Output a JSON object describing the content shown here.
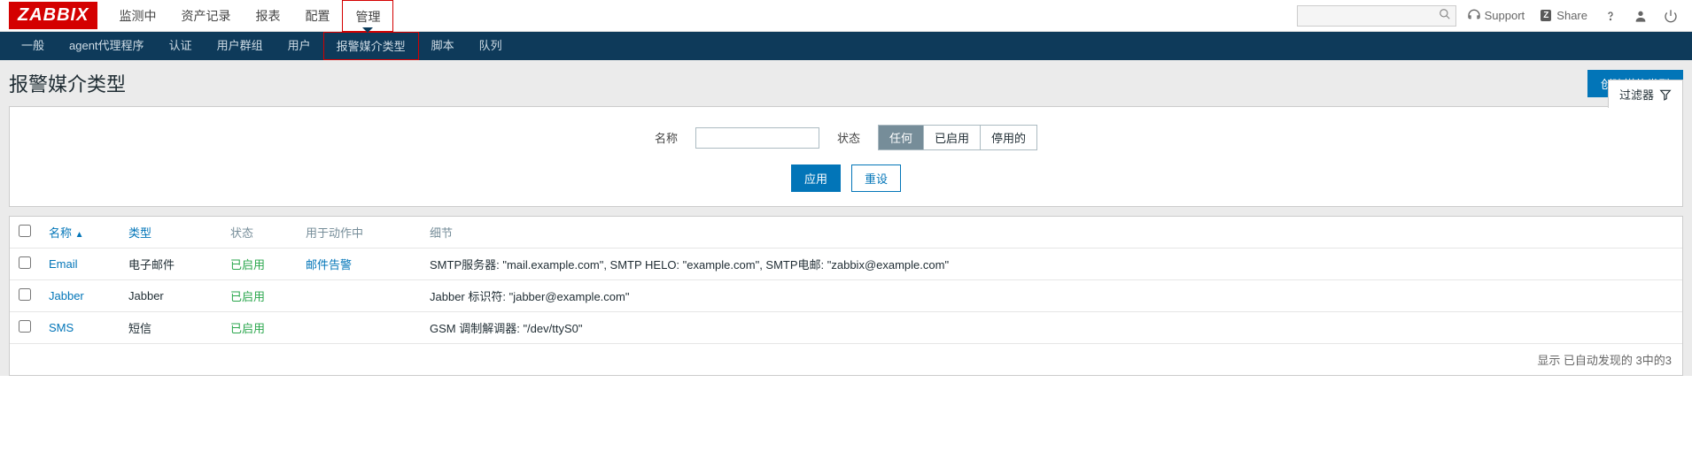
{
  "logo": "ZABBIX",
  "main_nav": {
    "items": [
      "监测中",
      "资产记录",
      "报表",
      "配置",
      "管理"
    ],
    "active_index": 4
  },
  "top_right": {
    "support": "Support",
    "share": "Share"
  },
  "sub_nav": {
    "items": [
      "一般",
      "agent代理程序",
      "认证",
      "用户群组",
      "用户",
      "报警媒介类型",
      "脚本",
      "队列"
    ],
    "active_index": 5
  },
  "page": {
    "title": "报警媒介类型",
    "create_button": "创建媒体类型"
  },
  "filter": {
    "tab_label": "过滤器",
    "name_label": "名称",
    "name_value": "",
    "state_label": "状态",
    "state_options": [
      "任何",
      "已启用",
      "停用的"
    ],
    "state_active_index": 0,
    "apply": "应用",
    "reset": "重设"
  },
  "table": {
    "headers": {
      "name": "名称",
      "type": "类型",
      "status": "状态",
      "used_in": "用于动作中",
      "detail": "细节"
    },
    "rows": [
      {
        "name": "Email",
        "type": "电子邮件",
        "status": "已启用",
        "used_in": "邮件告警",
        "detail": "SMTP服务器: \"mail.example.com\", SMTP HELO: \"example.com\", SMTP电邮: \"zabbix@example.com\""
      },
      {
        "name": "Jabber",
        "type": "Jabber",
        "status": "已启用",
        "used_in": "",
        "detail": "Jabber 标识符: \"jabber@example.com\""
      },
      {
        "name": "SMS",
        "type": "短信",
        "status": "已启用",
        "used_in": "",
        "detail": "GSM 调制解调器: \"/dev/ttyS0\""
      }
    ],
    "footer": "显示 已自动发现的 3中的3"
  }
}
